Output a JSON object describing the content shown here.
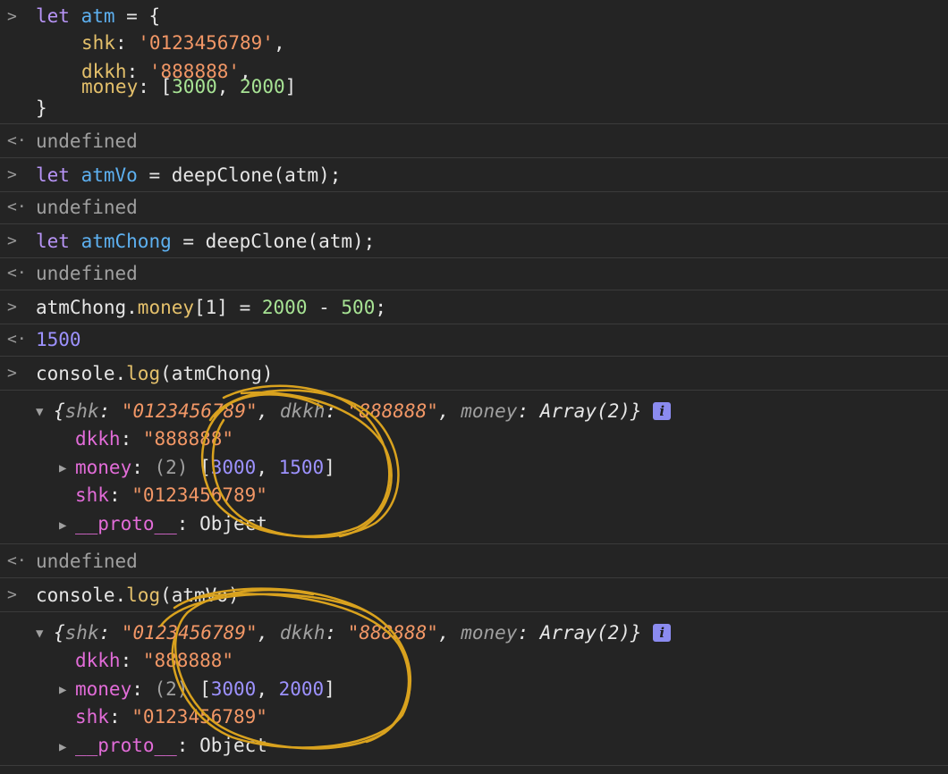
{
  "prompt_in": ">",
  "prompt_out": "<·",
  "block1": {
    "l1_kw": "let",
    "l1_var": "atm",
    "l1_rest": " = {",
    "l2_key": "shk",
    "l2_val": "'0123456789'",
    "l3_key": "dkkh",
    "l3_val": "'888888'",
    "l4_key": "money",
    "l4_n1": "3000",
    "l4_n2": "2000",
    "l5": "}",
    "result": "undefined"
  },
  "block2": {
    "kw": "let",
    "var": "atmVo",
    "rest": " = deepClone(atm);",
    "result": "undefined"
  },
  "block3": {
    "kw": "let",
    "var": "atmChong",
    "rest": " = deepClone(atm);",
    "result": "undefined"
  },
  "block4": {
    "obj": "atmChong.",
    "prop": "money",
    "idx": "[1]",
    "eq": " = ",
    "n1": "2000",
    "minus": " - ",
    "n2": "500",
    "semi": ";",
    "result": "1500"
  },
  "block5": {
    "cmd_obj": "console.",
    "cmd_fn": "log",
    "cmd_arg": "(atmChong)",
    "summary": {
      "open": "{",
      "k1": "shk",
      "v1": "\"0123456789\"",
      "k2": "dkkh",
      "v2": "\"888888\"",
      "k3": "money",
      "v3": "Array(2)",
      "close": "}"
    },
    "dkkh_key": "dkkh",
    "dkkh_val": "\"888888\"",
    "money_key": "money",
    "money_len": "(2)",
    "money_n1": "3000",
    "money_n2": "1500",
    "shk_key": "shk",
    "shk_val": "\"0123456789\"",
    "proto_key": "__proto__",
    "proto_val": "Object",
    "result": "undefined"
  },
  "block6": {
    "cmd_obj": "console.",
    "cmd_fn": "log",
    "cmd_arg": "(atmVo)",
    "summary": {
      "open": "{",
      "k1": "shk",
      "v1": "\"0123456789\"",
      "k2": "dkkh",
      "v2": "\"888888\"",
      "k3": "money",
      "v3": "Array(2)",
      "close": "}"
    },
    "dkkh_key": "dkkh",
    "dkkh_val": "\"888888\"",
    "money_key": "money",
    "money_len": "(2)",
    "money_n1": "3000",
    "money_n2": "2000",
    "shk_key": "shk",
    "shk_val": "\"0123456789\"",
    "proto_key": "__proto__",
    "proto_val": "Object"
  },
  "info_badge": "i",
  "colors": {
    "annotation": "#d9a21e",
    "background": "#242424"
  }
}
